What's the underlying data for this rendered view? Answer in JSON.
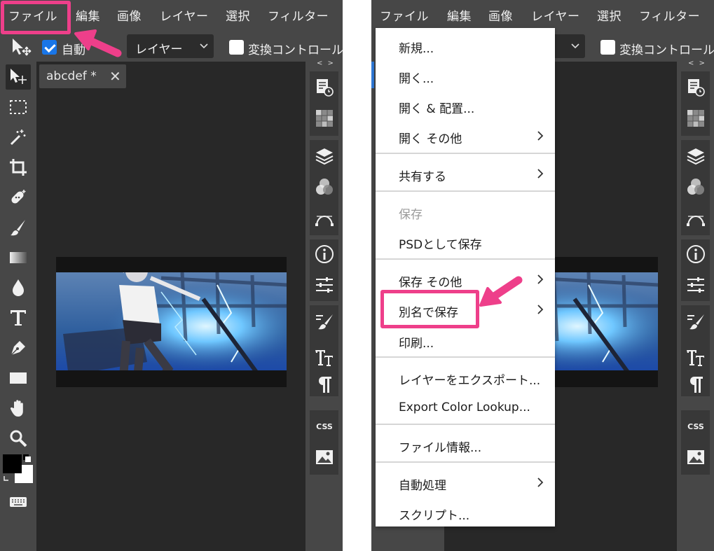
{
  "menubar": {
    "items": [
      "ファイル",
      "編集",
      "画像",
      "レイヤー",
      "選択",
      "フィルター"
    ]
  },
  "options_bar": {
    "auto_select_label": "自動",
    "auto_select_checked": true,
    "target_select_value": "レイヤー",
    "transform_controls_label": "変換コントロール",
    "transform_controls_checked": false
  },
  "document": {
    "tab_label": "abcdef *",
    "close_glyph": "✕"
  },
  "panel_strip": {
    "collapse_glyph": "< >",
    "css_label": "CSS"
  },
  "file_menu": {
    "items": [
      {
        "label": "新規...",
        "submenu": false,
        "disabled": false
      },
      {
        "label": "開く...",
        "submenu": false,
        "disabled": false
      },
      {
        "label": "開く & 配置...",
        "submenu": false,
        "disabled": false
      },
      {
        "label": "開く その他",
        "submenu": true,
        "disabled": false
      },
      {
        "label": "共有する",
        "submenu": true,
        "disabled": false
      },
      {
        "label": "保存",
        "submenu": false,
        "disabled": true
      },
      {
        "label": "PSDとして保存",
        "submenu": false,
        "disabled": false
      },
      {
        "label": "保存 その他",
        "submenu": true,
        "disabled": false
      },
      {
        "label": "別名で保存",
        "submenu": true,
        "disabled": false
      },
      {
        "label": "印刷...",
        "submenu": false,
        "disabled": false
      },
      {
        "label": "レイヤーをエクスポート...",
        "submenu": false,
        "disabled": false
      },
      {
        "label": "Export Color Lookup...",
        "submenu": false,
        "disabled": false
      },
      {
        "label": "ファイル情報...",
        "submenu": false,
        "disabled": false
      },
      {
        "label": "自動処理",
        "submenu": true,
        "disabled": false
      },
      {
        "label": "スクリプト...",
        "submenu": false,
        "disabled": false
      }
    ]
  },
  "colors": {
    "accent_highlight": "#ee3f8a",
    "checkbox_checked": "#1976e8",
    "panel_bg": "#474747",
    "canvas_bg": "#282828",
    "menu_bg": "#ffffff"
  },
  "icons": {
    "tools": [
      "move-icon",
      "marquee-icon",
      "magic-wand-icon",
      "crop-icon",
      "healing-icon",
      "brush-icon",
      "gradient-icon",
      "blur-drop-icon",
      "type-icon",
      "pen-icon",
      "rectangle-icon",
      "hand-icon",
      "zoom-icon",
      "color-swatch-icon",
      "keyboard-icon"
    ],
    "panels": [
      "history-icon",
      "swatches-icon",
      "layers-icon",
      "channels-icon",
      "paths-icon",
      "info-icon",
      "adjustments-icon",
      "brush-settings-icon",
      "character-icon",
      "paragraph-icon",
      "css-icon",
      "image-icon"
    ]
  }
}
